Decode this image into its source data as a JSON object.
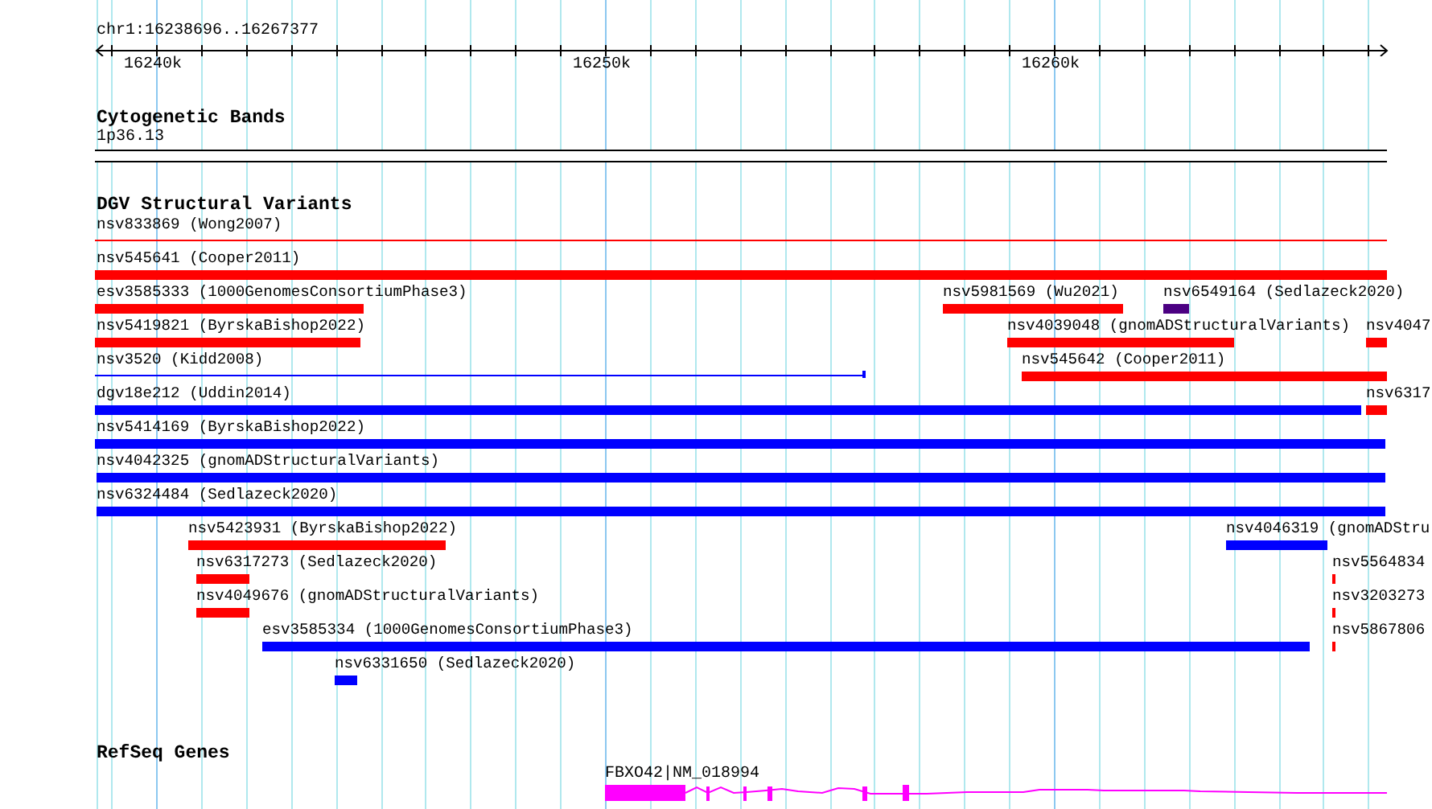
{
  "ruler": {
    "location": "chr1:16238696..16267377",
    "tick_labels": [
      "16240k",
      "16250k",
      "16260k"
    ]
  },
  "cytogenetic_bands": {
    "title": "Cytogenetic Bands",
    "band": "1p36.13"
  },
  "dgv_track": {
    "title": "DGV Structural Variants",
    "rows": [
      [
        {
          "label": "nsv833869 (Wong2007)",
          "color": "#ff0000",
          "kind": "line"
        }
      ],
      [
        {
          "label": "nsv545641 (Cooper2011)",
          "color": "#ff0000",
          "kind": "bar"
        }
      ],
      [
        {
          "label": "esv3585333 (1000GenomesConsortiumPhase3)",
          "color": "#ff0000",
          "kind": "bar"
        },
        {
          "label": "nsv5981569 (Wu2021)",
          "color": "#ff0000",
          "kind": "bar"
        },
        {
          "label": "nsv6549164 (Sedlazeck2020)",
          "color": "#4b0082",
          "kind": "bar"
        }
      ],
      [
        {
          "label": "nsv5419821 (ByrskaBishop2022)",
          "color": "#ff0000",
          "kind": "bar"
        },
        {
          "label": "nsv4039048 (gnomADStructuralVariants)",
          "color": "#ff0000",
          "kind": "bar"
        },
        {
          "label": "nsv4047",
          "color": "#ff0000",
          "kind": "bar"
        }
      ],
      [
        {
          "label": "nsv3520 (Kidd2008)",
          "color": "#0000ff",
          "kind": "line"
        },
        {
          "label": "nsv545642 (Cooper2011)",
          "color": "#ff0000",
          "kind": "bar"
        }
      ],
      [
        {
          "label": "dgv18e212 (Uddin2014)",
          "color": "#0000ff",
          "kind": "bar"
        },
        {
          "label": "nsv6317",
          "color": "#ff0000",
          "kind": "bar"
        }
      ],
      [
        {
          "label": "nsv5414169 (ByrskaBishop2022)",
          "color": "#0000ff",
          "kind": "bar"
        }
      ],
      [
        {
          "label": "nsv4042325 (gnomADStructuralVariants)",
          "color": "#0000ff",
          "kind": "bar"
        }
      ],
      [
        {
          "label": "nsv6324484 (Sedlazeck2020)",
          "color": "#0000ff",
          "kind": "bar"
        }
      ],
      [
        {
          "label": "nsv5423931 (ByrskaBishop2022)",
          "color": "#ff0000",
          "kind": "bar"
        },
        {
          "label": "nsv4046319 (gnomADStru",
          "color": "#0000ff",
          "kind": "bar"
        }
      ],
      [
        {
          "label": "nsv6317273 (Sedlazeck2020)",
          "color": "#ff0000",
          "kind": "bar"
        },
        {
          "label": "nsv5564834",
          "color": "#ff0000",
          "kind": "bar"
        }
      ],
      [
        {
          "label": "nsv4049676 (gnomADStructuralVariants)",
          "color": "#ff0000",
          "kind": "bar"
        },
        {
          "label": "nsv3203273",
          "color": "#ff0000",
          "kind": "bar"
        }
      ],
      [
        {
          "label": "esv3585334 (1000GenomesConsortiumPhase3)",
          "color": "#0000ff",
          "kind": "bar"
        },
        {
          "label": "nsv5867806",
          "color": "#ff0000",
          "kind": "bar"
        }
      ],
      [
        {
          "label": "nsv6331650 (Sedlazeck2020)",
          "color": "#0000ff",
          "kind": "bar"
        }
      ]
    ]
  },
  "refseq_track": {
    "title": "RefSeq Genes",
    "gene": "FBXO42|NM_018994"
  }
}
